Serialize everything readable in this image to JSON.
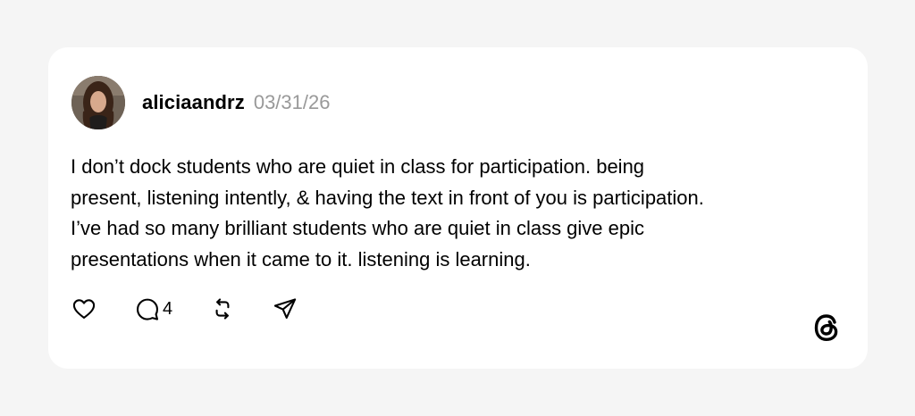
{
  "post": {
    "username": "aliciaandrz",
    "date": "03/31/26",
    "avatar_icon": "avatar-photo",
    "text_lines": [
      "I don’t dock students who are quiet in class for participation. being",
      "present, listening intently, & having the text in front of you is participation.",
      "I’ve had so many brilliant students who are quiet in class give epic",
      "presentations when it came to it. listening is learning."
    ]
  },
  "actions": {
    "like_icon": "heart-icon",
    "reply_icon": "comment-icon",
    "reply_count": "4",
    "repost_icon": "repost-icon",
    "share_icon": "send-icon"
  },
  "brand": {
    "logo_icon": "threads-logo-icon"
  },
  "colors": {
    "background": "#f5f5f5",
    "card": "#ffffff",
    "text": "#000000",
    "muted": "#999999"
  }
}
